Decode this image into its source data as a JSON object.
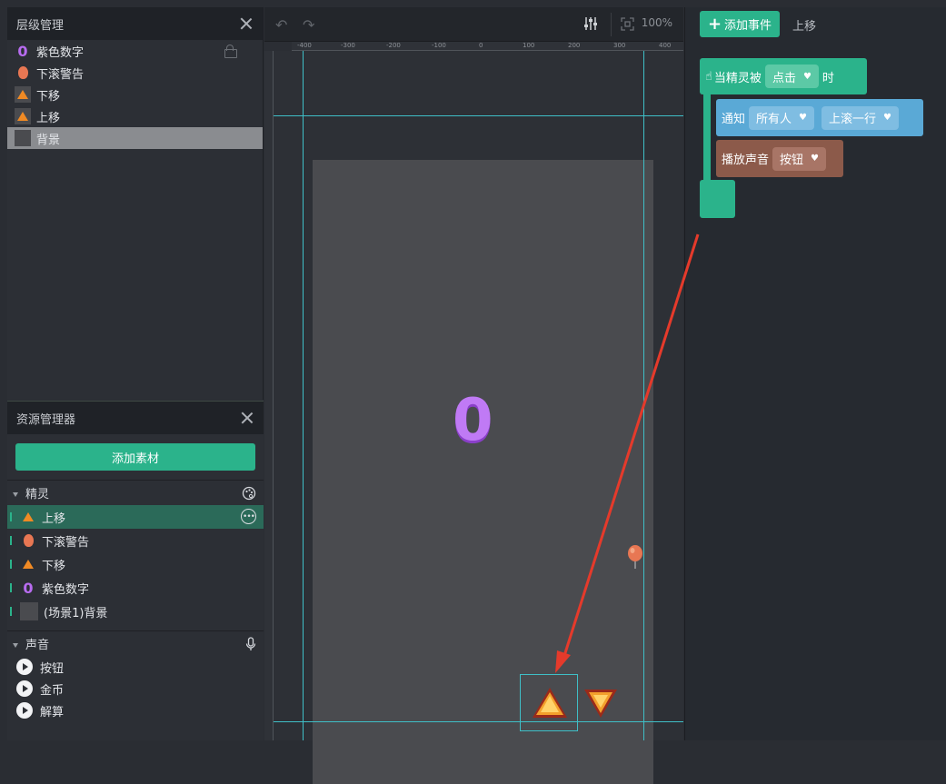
{
  "layers_panel": {
    "title": "层级管理",
    "items": [
      {
        "label": "紫色数字",
        "icon": "purple-zero-icon"
      },
      {
        "label": "下滚警告",
        "icon": "balloon-icon"
      },
      {
        "label": "下移",
        "icon": "triangle-icon"
      },
      {
        "label": "上移",
        "icon": "triangle-icon"
      },
      {
        "label": "背景",
        "icon": "background-thumb"
      }
    ],
    "selected": "背景"
  },
  "assets_panel": {
    "title": "资源管理器",
    "add_button": "添加素材",
    "sprites_section": "精灵",
    "sprites": [
      {
        "label": "上移",
        "icon": "triangle-icon"
      },
      {
        "label": "下滚警告",
        "icon": "balloon-icon"
      },
      {
        "label": "下移",
        "icon": "triangle-icon"
      },
      {
        "label": "紫色数字",
        "icon": "purple-zero-icon"
      },
      {
        "label": "(场景1)背景",
        "icon": "background-thumb"
      }
    ],
    "active_sprite": "上移",
    "sounds_section": "声音",
    "sounds": [
      {
        "label": "按钮"
      },
      {
        "label": "金币"
      },
      {
        "label": "解算"
      }
    ]
  },
  "stage": {
    "zoom": "100%",
    "big_number": "0",
    "ruler_top": [
      "-400",
      "-300",
      "-200",
      "-100",
      "0",
      "100",
      "200",
      "300",
      "400"
    ]
  },
  "editor": {
    "add_event_label": "添加事件",
    "add_event_icon": "plus-icon",
    "current_sprite": "上移",
    "event_block": {
      "prefix": "当精灵被",
      "dropdown": "点击",
      "suffix": "时",
      "color": "#2bb38b"
    },
    "notify_block": {
      "label": "通知",
      "target": "所有人",
      "message": "上滚一行",
      "color": "#5aa9d6"
    },
    "sound_block": {
      "label": "播放声音",
      "sound": "按钮",
      "color": "#8c5a4a"
    }
  },
  "colors": {
    "accent": "#2bb38b",
    "guide": "#3fbfc7",
    "arrow": "#e53a2b"
  }
}
